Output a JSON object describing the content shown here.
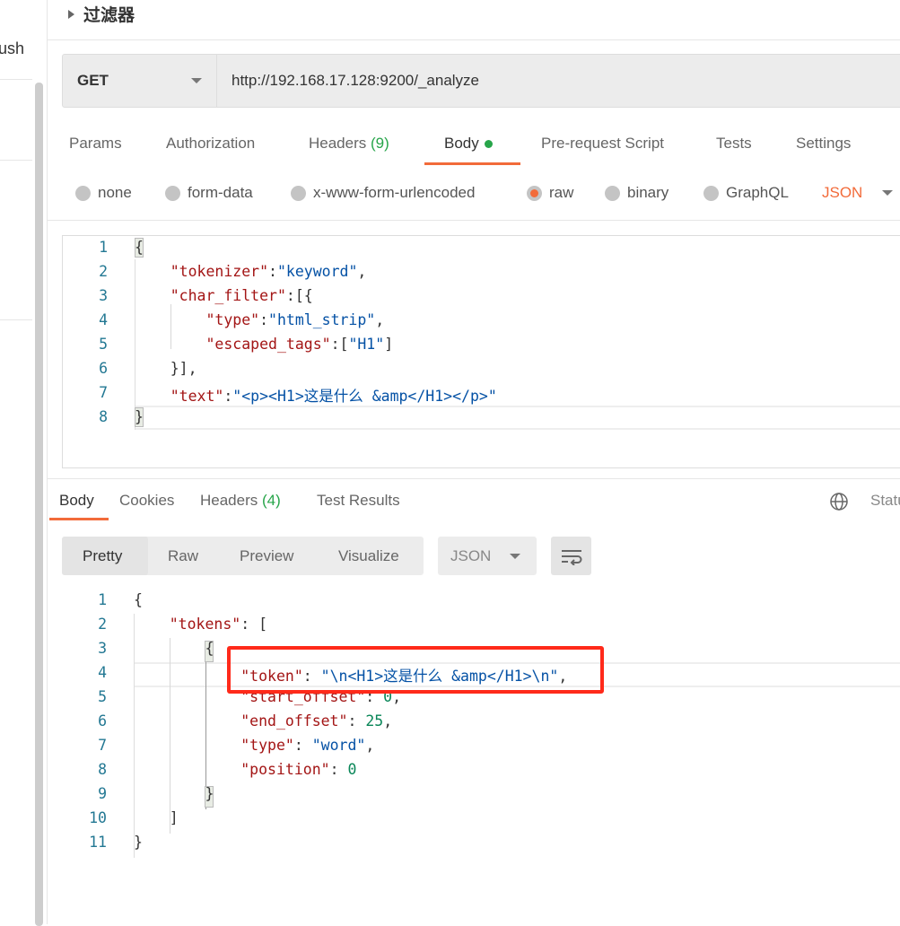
{
  "sidebar": {
    "partial_text": "ush"
  },
  "section": {
    "title": "过滤器"
  },
  "request": {
    "method": "GET",
    "url": "http://192.168.17.128:9200/_analyze",
    "tabs": [
      {
        "label": "Params"
      },
      {
        "label": "Authorization"
      },
      {
        "label": "Headers",
        "count": "(9)"
      },
      {
        "label": "Body",
        "active": true
      },
      {
        "label": "Pre-request Script"
      },
      {
        "label": "Tests"
      },
      {
        "label": "Settings"
      }
    ],
    "body_types": [
      {
        "label": "none",
        "selected": false
      },
      {
        "label": "form-data",
        "selected": false
      },
      {
        "label": "x-www-form-urlencoded",
        "selected": false
      },
      {
        "label": "raw",
        "selected": true
      },
      {
        "label": "binary",
        "selected": false
      },
      {
        "label": "GraphQL",
        "selected": false
      }
    ],
    "format": "JSON",
    "code": [
      [
        [
          "p",
          "{"
        ]
      ],
      [
        [
          "p",
          "    "
        ],
        [
          "k",
          "\"tokenizer\""
        ],
        [
          "p",
          ":"
        ],
        [
          "s",
          "\"keyword\""
        ],
        [
          "p",
          ","
        ]
      ],
      [
        [
          "p",
          "    "
        ],
        [
          "k",
          "\"char_filter\""
        ],
        [
          "p",
          ":[{"
        ]
      ],
      [
        [
          "p",
          "        "
        ],
        [
          "k",
          "\"type\""
        ],
        [
          "p",
          ":"
        ],
        [
          "s",
          "\"html_strip\""
        ],
        [
          "p",
          ","
        ]
      ],
      [
        [
          "p",
          "        "
        ],
        [
          "k",
          "\"escaped_tags\""
        ],
        [
          "p",
          ":["
        ],
        [
          "s",
          "\"H1\""
        ],
        [
          "p",
          "]"
        ]
      ],
      [
        [
          "p",
          "    }],"
        ]
      ],
      [
        [
          "p",
          "    "
        ],
        [
          "k",
          "\"text\""
        ],
        [
          "p",
          ":"
        ],
        [
          "s",
          "\"<p><H1>这是什么 &amp</H1></p>\""
        ]
      ],
      [
        [
          "p",
          "}"
        ]
      ]
    ]
  },
  "response": {
    "tabs": [
      {
        "label": "Body",
        "active": true
      },
      {
        "label": "Cookies"
      },
      {
        "label": "Headers",
        "count": "(4)"
      },
      {
        "label": "Test Results"
      }
    ],
    "status_partial": "Statu",
    "view_modes": [
      "Pretty",
      "Raw",
      "Preview",
      "Visualize"
    ],
    "active_view": "Pretty",
    "format": "JSON",
    "code": [
      [
        [
          "p",
          "{"
        ]
      ],
      [
        [
          "p",
          "    "
        ],
        [
          "k",
          "\"tokens\""
        ],
        [
          "p",
          ": ["
        ]
      ],
      [
        [
          "p",
          "        {"
        ]
      ],
      [
        [
          "p",
          "            "
        ],
        [
          "k",
          "\"token\""
        ],
        [
          "p",
          ": "
        ],
        [
          "s",
          "\"\\n<H1>这是什么 &amp</H1>\\n\""
        ],
        [
          "p",
          ","
        ]
      ],
      [
        [
          "p",
          "            "
        ],
        [
          "k",
          "\"start_offset\""
        ],
        [
          "p",
          ": "
        ],
        [
          "n",
          "0"
        ],
        [
          "p",
          ","
        ]
      ],
      [
        [
          "p",
          "            "
        ],
        [
          "k",
          "\"end_offset\""
        ],
        [
          "p",
          ": "
        ],
        [
          "n",
          "25"
        ],
        [
          "p",
          ","
        ]
      ],
      [
        [
          "p",
          "            "
        ],
        [
          "k",
          "\"type\""
        ],
        [
          "p",
          ": "
        ],
        [
          "s",
          "\"word\""
        ],
        [
          "p",
          ","
        ]
      ],
      [
        [
          "p",
          "            "
        ],
        [
          "k",
          "\"position\""
        ],
        [
          "p",
          ": "
        ],
        [
          "n",
          "0"
        ]
      ],
      [
        [
          "p",
          "        }"
        ]
      ],
      [
        [
          "p",
          "    ]"
        ]
      ],
      [
        [
          "p",
          "}"
        ]
      ]
    ]
  },
  "colors": {
    "accent": "#f26b3a",
    "count_green": "#27a54a",
    "highlight_box": "#ff2a1a",
    "json_key": "#a31515",
    "json_string": "#0451a5",
    "json_number": "#098658"
  }
}
